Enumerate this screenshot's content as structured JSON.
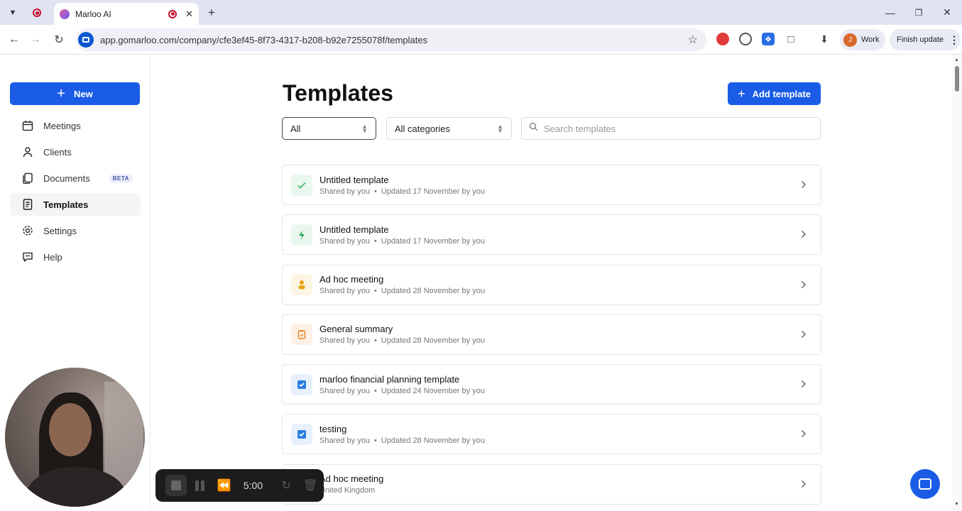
{
  "browser": {
    "tab_title": "Marloo AI",
    "url": "app.gomarloo.com/company/cfe3ef45-8f73-4317-b208-b92e7255078f/templates",
    "profile_initial": "J",
    "profile_label": "Work",
    "finish_update_label": "Finish update"
  },
  "sidebar": {
    "new_label": "New",
    "items": [
      {
        "label": "Meetings",
        "icon": "calendar-icon"
      },
      {
        "label": "Clients",
        "icon": "person-icon"
      },
      {
        "label": "Documents",
        "icon": "documents-icon",
        "badge": "BETA"
      },
      {
        "label": "Templates",
        "icon": "template-icon",
        "active": true
      },
      {
        "label": "Settings",
        "icon": "gear-icon"
      },
      {
        "label": "Help",
        "icon": "chat-icon"
      }
    ]
  },
  "main": {
    "title": "Templates",
    "add_label": "Add template",
    "filter_owner": "All",
    "filter_category": "All categories",
    "search_placeholder": "Search templates"
  },
  "templates": [
    {
      "name": "Untitled template",
      "shared": "Shared by you",
      "updated": "Updated 17 November by you",
      "icon": "check-icon",
      "icon_color": "#3fb86a",
      "icon_bg": "#eaf7ef"
    },
    {
      "name": "Untitled template",
      "shared": "Shared by you",
      "updated": "Updated 17 November by you",
      "icon": "lightning-icon",
      "icon_color": "#2fa85a",
      "icon_bg": "#eaf7ef"
    },
    {
      "name": "Ad hoc meeting",
      "shared": "Shared by you",
      "updated": "Updated 28 November by you",
      "icon": "person-icon",
      "icon_color": "#e8a317",
      "icon_bg": "#fdf5e3"
    },
    {
      "name": "General summary",
      "shared": "Shared by you",
      "updated": "Updated 28 November by you",
      "icon": "clipboard-icon",
      "icon_color": "#e8862c",
      "icon_bg": "#fdf1e5"
    },
    {
      "name": "marloo financial planning template",
      "shared": "Shared by you",
      "updated": "Updated 24 November by you",
      "icon": "checkbox-icon",
      "icon_color": "#2a7de1",
      "icon_bg": "#e7f0fc"
    },
    {
      "name": "testing",
      "shared": "Shared by you",
      "updated": "Updated 28 November by you",
      "icon": "checkbox-icon",
      "icon_color": "#2a7de1",
      "icon_bg": "#e7f0fc"
    },
    {
      "name": "Ad hoc meeting",
      "shared": "United Kingdom",
      "updated": "",
      "icon": "person-icon",
      "icon_color": "#e8a317",
      "icon_bg": "#fdf5e3"
    }
  ],
  "recorder": {
    "time": "5:00"
  }
}
